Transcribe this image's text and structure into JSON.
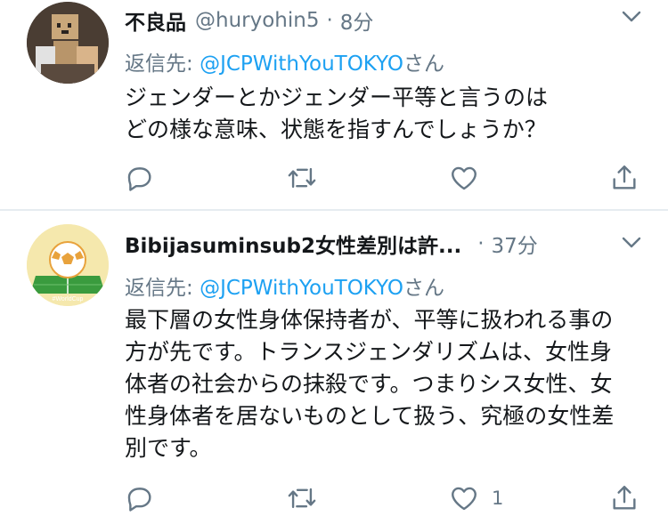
{
  "tweets": [
    {
      "name": "不良品",
      "handle": "@huryohin5",
      "separator": "·",
      "time": "8分",
      "reply_prefix": "返信先: ",
      "reply_to": "@JCPWithYouTOKYO",
      "reply_suffix": "さん",
      "lines": [
        "ジェンダーとかジェンダー平等と言うのは",
        "どの様な意味、状態を指すんでしょうか？"
      ],
      "like_count": ""
    },
    {
      "name": "Bibijasuminsub2女性差別は許...",
      "handle": "",
      "separator": "·",
      "time": "37分",
      "reply_prefix": "返信先: ",
      "reply_to": "@JCPWithYouTOKYO",
      "reply_suffix": "さん",
      "lines": [
        "最下層の女性身体保持者が、平等に扱われる事の",
        "方が先です。トランスジェンダリズムは、女性身",
        "体者の社会からの抹殺です。つまりシス女性、女",
        "性身体者を居ないものとして扱う、究極の女性差",
        "別です。"
      ],
      "like_count": "1",
      "avatar_label": "#WorldCup"
    }
  ],
  "colors": {
    "accent": "#1da1f2",
    "secondary_text": "#657786",
    "divider": "#e6ecf0"
  },
  "icons": [
    "reply-icon",
    "retweet-icon",
    "like-icon",
    "share-icon",
    "chevron-down-icon"
  ]
}
